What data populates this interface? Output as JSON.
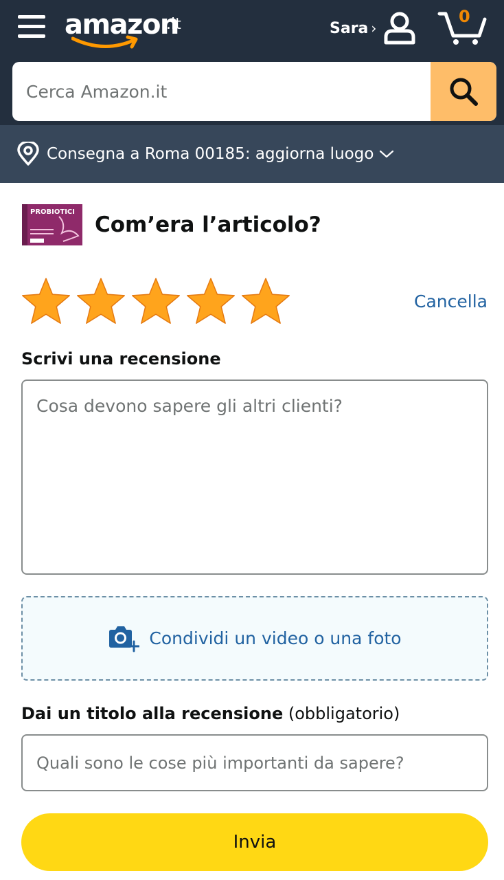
{
  "header": {
    "logo_text": "amazon",
    "logo_tld": ".it",
    "user_name": "Sara",
    "user_chevron": "›",
    "cart_count": "0",
    "icons": [
      "menu-icon",
      "user-icon",
      "cart-icon",
      "search-icon",
      "location-pin-icon",
      "chevron-down-icon"
    ]
  },
  "search": {
    "placeholder": "Cerca Amazon.it",
    "value": ""
  },
  "delivery": {
    "text": "Consegna a Roma 00185: aggiorna luogo"
  },
  "product": {
    "image_text": "PROBIOTICI",
    "question": "Com’era l’articolo?"
  },
  "rating": {
    "value": 5,
    "max": 5,
    "cancel_label": "Cancella"
  },
  "review": {
    "label": "Scrivi una recensione",
    "placeholder": "Cosa devono sapere gli altri clienti?",
    "value": ""
  },
  "media": {
    "label": "Condividi un video o una foto"
  },
  "title_field": {
    "label_bold": "Dai un titolo alla recensione",
    "label_suffix": " (obbligatorio)",
    "placeholder": "Quali sono le cose più importanti da sapere?",
    "value": ""
  },
  "submit": {
    "label": "Invia"
  },
  "colors": {
    "header_bg": "#232f3e",
    "delivery_bg": "#37475a",
    "search_button": "#febd69",
    "star": "#ffa41c",
    "link": "#2162a1",
    "submit_bg": "#ffd814",
    "cart_count": "#f08804"
  }
}
